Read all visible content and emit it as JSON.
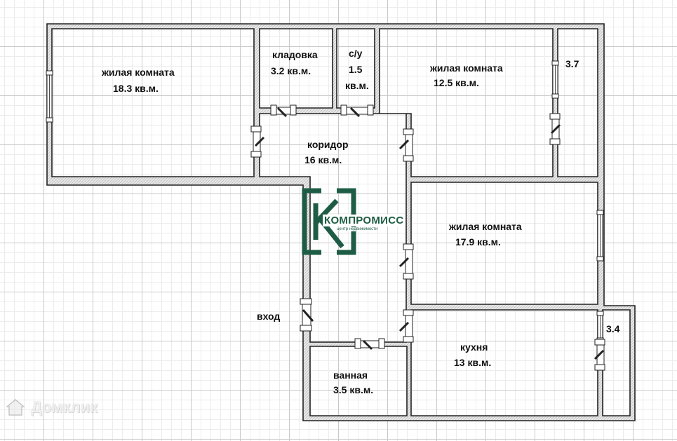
{
  "rooms": {
    "living_1": {
      "name": "жилая комната",
      "area": "18.3 кв.м."
    },
    "storage": {
      "name": "кладовка",
      "area": "3.2 кв.м."
    },
    "wc": {
      "name": "с/у",
      "area_number": "1.5",
      "area_unit": "кв.м."
    },
    "living_2": {
      "name": "жилая комната",
      "area": "12.5 кв.м."
    },
    "balcony_top": {
      "area": "3.7"
    },
    "corridor": {
      "name": "коридор",
      "area": "16 кв.м."
    },
    "living_3": {
      "name": "жилая комната",
      "area": "17.9 кв.м."
    },
    "kitchen": {
      "name": "кухня",
      "area": "13 кв.м."
    },
    "balcony_bottom": {
      "area": "3.4"
    },
    "bathroom": {
      "name": "ванная",
      "area": "3.5 кв.м."
    }
  },
  "entrance": {
    "label": "вход"
  },
  "logo": {
    "name": "КОМПРОМИСС",
    "tagline": "центр недвижимости",
    "color": "#1e5c45"
  },
  "watermark": {
    "text": "Домклик",
    "icon": "house-icon"
  },
  "colors": {
    "wall_fill": "#e6e6e6",
    "wall_stroke": "#222222"
  }
}
